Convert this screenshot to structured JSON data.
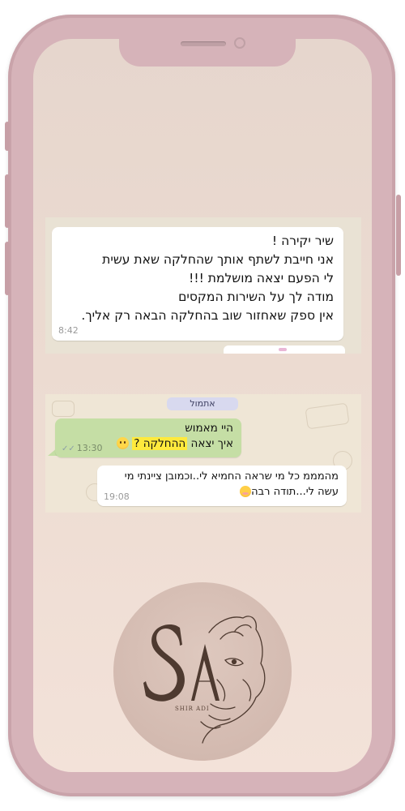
{
  "messages": {
    "testimonial": {
      "lines": [
        "שיר יקירה !",
        "אני חייבת לשתף אותך שהחלקה שאת עשית",
        "לי הפעם יצאה מושלמת !!!",
        "מודה לך על השירות המקסים",
        "אין ספק שאחזור שוב בהחלקה הבאה רק אליך."
      ],
      "time": "8:42"
    },
    "date_chip": "אתמול",
    "outgoing": {
      "line1": "היי מאמוש",
      "line2_prefix": "איך יצאה ",
      "line2_highlight": "ההחלקה ?",
      "time": "13:30",
      "ticks": "✓✓"
    },
    "reply": {
      "line1": "מהמממ כל מי שראה החמיא לי..וכמובן ציינתי מי",
      "line2": "עשה לי...תודה רבה",
      "time": "19:08"
    }
  },
  "brand": {
    "monogram": "SA",
    "name": "SHIR ADI"
  },
  "colors": {
    "phone_frame": "#d6b3b9",
    "outgoing_bubble": "#c5dea5",
    "highlight": "#ffea3d",
    "logo_ink": "#4e3a30"
  }
}
